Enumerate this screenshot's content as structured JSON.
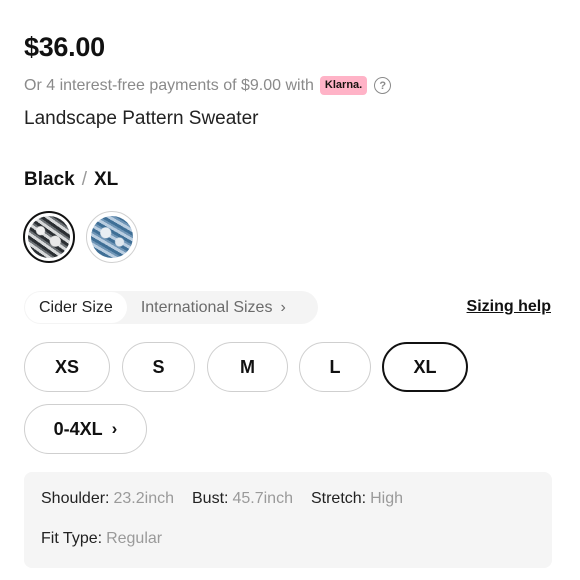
{
  "product": {
    "price": "$36.00",
    "installments_text": "Or 4 interest-free payments of $9.00 with",
    "klarna_label": "Klarna.",
    "name": "Landscape Pattern Sweater"
  },
  "variant": {
    "color": "Black",
    "separator": "/",
    "size": "XL"
  },
  "swatches": [
    {
      "name": "black-landscape-pattern",
      "selected": true
    },
    {
      "name": "blue-landscape-pattern",
      "selected": false
    }
  ],
  "size_tabs": {
    "cider": "Cider Size",
    "international": "International Sizes",
    "chevron": "›"
  },
  "sizing_help": "Sizing help",
  "sizes": {
    "xs": "XS",
    "s": "S",
    "m": "M",
    "l": "L",
    "xl": "XL",
    "extended": "0-4XL",
    "extended_chevron": "›",
    "selected": "XL"
  },
  "fit": {
    "shoulder_label": "Shoulder:",
    "shoulder_value": "23.2inch",
    "bust_label": "Bust:",
    "bust_value": "45.7inch",
    "stretch_label": "Stretch:",
    "stretch_value": "High",
    "fit_type_label": "Fit Type:",
    "fit_type_value": "Regular"
  },
  "colors": {
    "klarna_pink": "#ffb3c7",
    "muted_text": "#8a8a8a",
    "selected_border": "#111111"
  }
}
